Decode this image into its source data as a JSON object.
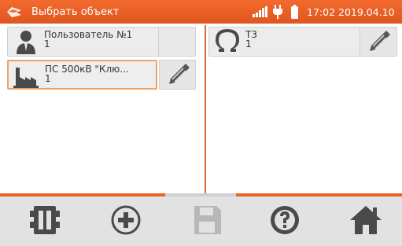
{
  "header": {
    "title": "Выбрать объект",
    "clock": "17:02 2019.04.10",
    "icons": [
      "logo-icon",
      "signal-icon",
      "plug-icon",
      "battery-icon"
    ]
  },
  "left_panel": {
    "items": [
      {
        "icon": "person-icon",
        "name": "Пользователь №1",
        "number": "1",
        "selected": false
      },
      {
        "icon": "factory-icon",
        "name": "ПС 500кВ \"Клю...",
        "number": "1",
        "selected": true
      }
    ]
  },
  "right_panel": {
    "items": [
      {
        "icon": "omega-icon",
        "name": "Т3",
        "number": "1"
      }
    ]
  },
  "toolbar": {
    "buttons": [
      "tree-icon",
      "add-icon",
      "save-icon",
      "help-icon",
      "home-icon"
    ],
    "disabled": [
      "save-icon"
    ]
  },
  "colors": {
    "accent": "#e8622a",
    "card_bg": "#ececec",
    "toolbar_bg": "#e2e2e2",
    "icon_dark": "#4a4a4a",
    "icon_disabled": "#b8b8b8"
  }
}
